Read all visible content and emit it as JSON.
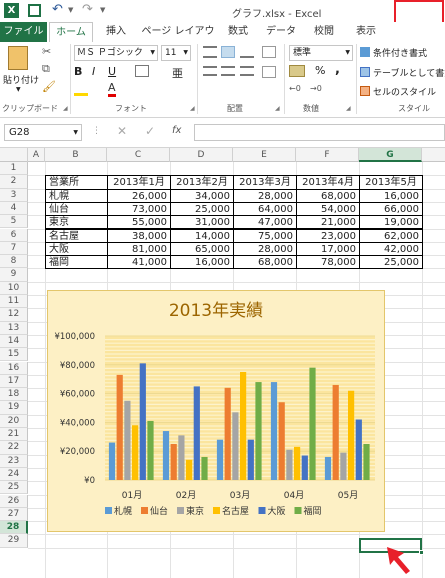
{
  "title": "グラフ.xlsx - Excel",
  "quick_access": {
    "save_icon": "save-icon",
    "undo_icon": "undo-icon",
    "redo_icon": "redo-icon"
  },
  "tabs": [
    "ファイル",
    "ホーム",
    "挿入",
    "ページ レイアウト",
    "数式",
    "データ",
    "校閲",
    "表示"
  ],
  "active_tab": "ホーム",
  "ribbon": {
    "clipboard": {
      "paste_label": "貼り付け",
      "group_label": "クリップボード"
    },
    "font": {
      "font_name": "ＭＳ Ｐゴシック",
      "font_size": "11",
      "bold": "B",
      "italic": "I",
      "underline": "U",
      "grow": "A",
      "shrink": "A",
      "color_a": "A",
      "kana": "亜",
      "group_label": "フォント"
    },
    "alignment": {
      "group_label": "配置"
    },
    "number": {
      "format": "標準",
      "percent": "%",
      "comma": ",",
      "group_label": "数値"
    },
    "styles": {
      "conditional": "条件付き書式",
      "table": "テーブルとして書式",
      "cell_style": "セルのスタイル",
      "group_label": "スタイル"
    }
  },
  "name_box": "G28",
  "fx": "fx",
  "columns": [
    "A",
    "B",
    "C",
    "D",
    "E",
    "F",
    "G"
  ],
  "rows": [
    "1",
    "2",
    "3",
    "4",
    "5",
    "6",
    "7",
    "8",
    "9",
    "10",
    "11",
    "12",
    "13",
    "14",
    "15",
    "16",
    "17",
    "18",
    "19",
    "20",
    "21",
    "22",
    "23",
    "24",
    "25",
    "26",
    "27",
    "28",
    "29"
  ],
  "table": {
    "headers": [
      "営業所",
      "2013年1月",
      "2013年2月",
      "2013年3月",
      "2013年4月",
      "2013年5月"
    ],
    "rows": [
      [
        "札幌",
        "26,000",
        "34,000",
        "28,000",
        "68,000",
        "16,000"
      ],
      [
        "仙台",
        "73,000",
        "25,000",
        "64,000",
        "54,000",
        "66,000"
      ],
      [
        "東京",
        "55,000",
        "31,000",
        "47,000",
        "21,000",
        "19,000"
      ],
      [
        "名古屋",
        "38,000",
        "14,000",
        "75,000",
        "23,000",
        "62,000"
      ],
      [
        "大阪",
        "81,000",
        "65,000",
        "28,000",
        "17,000",
        "42,000"
      ],
      [
        "福岡",
        "41,000",
        "16,000",
        "68,000",
        "78,000",
        "25,000"
      ]
    ]
  },
  "chart_data": {
    "type": "bar",
    "title": "2013年実績",
    "categories": [
      "01月",
      "02月",
      "03月",
      "04月",
      "05月"
    ],
    "ylim": [
      0,
      100000
    ],
    "yticks": [
      "¥0",
      "¥20,000",
      "¥40,000",
      "¥60,000",
      "¥80,000",
      "¥100,000"
    ],
    "series": [
      {
        "name": "札幌",
        "color": "#5b9bd5",
        "values": [
          26000,
          34000,
          28000,
          68000,
          16000
        ]
      },
      {
        "name": "仙台",
        "color": "#ed7d31",
        "values": [
          73000,
          25000,
          64000,
          54000,
          66000
        ]
      },
      {
        "name": "東京",
        "color": "#a5a5a5",
        "values": [
          55000,
          31000,
          47000,
          21000,
          19000
        ]
      },
      {
        "name": "名古屋",
        "color": "#ffc000",
        "values": [
          38000,
          14000,
          75000,
          23000,
          62000
        ]
      },
      {
        "name": "大阪",
        "color": "#4472c4",
        "values": [
          81000,
          65000,
          28000,
          17000,
          42000
        ]
      },
      {
        "name": "福岡",
        "color": "#70ad47",
        "values": [
          41000,
          16000,
          68000,
          78000,
          25000
        ]
      }
    ],
    "title_color": "#9c6500",
    "background": "#fdf0c5"
  }
}
